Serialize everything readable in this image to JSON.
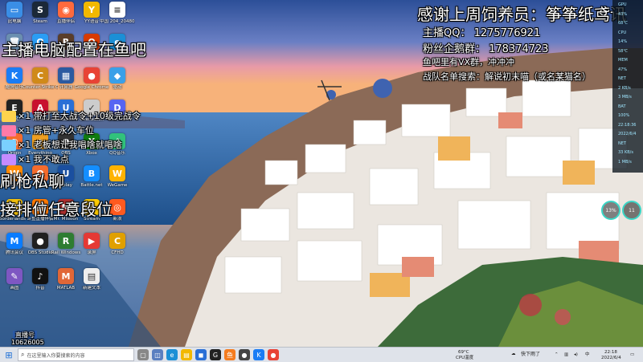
{
  "overlay": {
    "thanks": "感谢上周饲养员：筝筝纸鸢讯",
    "anchor_qq": "主播QQ：  1275776921",
    "fan_group": "粉丝企鹅群：  178374723",
    "vx_group": "鱼吧里有VX群，冲冲冲",
    "team_notice": "战队名单搜索：解说初末喵（或名某猫名）",
    "config": "主播电脑配置在鱼吧",
    "brush": "刷枪私聊",
    "rank": "接排位任意段位",
    "gifts": [
      "×1 带打至大战令+10级完战令",
      "×1 房管+永久车位",
      "×1 老板想让我唱啥就唱啥",
      "×1 我不敢点"
    ],
    "corner_id_label": "直播号",
    "corner_id": "10626005"
  },
  "desktop_icons": [
    {
      "label": "此电脑",
      "glyph": "▭",
      "color": "#3a8ee6"
    },
    {
      "label": "Steam",
      "glyph": "S",
      "color": "#1b2838"
    },
    {
      "label": "直播伴侣",
      "glyph": "◉",
      "color": "#ff6a3d"
    },
    {
      "label": "YY语音",
      "glyph": "Y",
      "color": "#f2b800"
    },
    {
      "label": "中国 204_20480...",
      "glyph": "≡",
      "color": "#ffffff"
    },
    {
      "label": "回收站",
      "glyph": "🗑",
      "color": "#6b8fb0"
    },
    {
      "label": "腾讯QQ",
      "glyph": "Q",
      "color": "#2a9df4"
    },
    {
      "label": "Rising Storm",
      "glyph": "R",
      "color": "#5a3e2b"
    },
    {
      "label": "Office",
      "glyph": "O",
      "color": "#d83b01"
    },
    {
      "label": "Microsoft Edge",
      "glyph": "e",
      "color": "#1b8fd6"
    },
    {
      "label": "酷狗音乐",
      "glyph": "K",
      "color": "#1a7cf5"
    },
    {
      "label": "Counter-Strike Global Off...",
      "glyph": "C",
      "color": "#d08a1a"
    },
    {
      "label": "计算器",
      "glyph": "▦",
      "color": "#2c5aa0"
    },
    {
      "label": "Google Chrome",
      "glyph": "●",
      "color": "#e84335"
    },
    {
      "label": "驱动",
      "glyph": "◆",
      "color": "#3aa0e8"
    },
    {
      "label": "EPIC",
      "glyph": "E",
      "color": "#222222"
    },
    {
      "label": "Adobe",
      "glyph": "A",
      "color": "#c8102e"
    },
    {
      "label": "Ubisoft",
      "glyph": "U",
      "color": "#2a6fd6"
    },
    {
      "label": "Overwatch",
      "glyph": "✓",
      "color": "#cccccc"
    },
    {
      "label": "Discord",
      "glyph": "D",
      "color": "#5865f2"
    },
    {
      "label": "Origin",
      "glyph": "◐",
      "color": "#f56c2d"
    },
    {
      "label": "Everything",
      "glyph": "⌕",
      "color": "#f0a020"
    },
    {
      "label": "OBS",
      "glyph": "●",
      "color": "#333333"
    },
    {
      "label": "Xbox",
      "glyph": "X",
      "color": "#107c10"
    },
    {
      "label": "QQ音乐",
      "glyph": "♪",
      "color": "#31c27c"
    },
    {
      "label": "WeGame",
      "glyph": "W",
      "color": "#ff8a00"
    },
    {
      "label": "Origin",
      "glyph": "O",
      "color": "#f56c2d"
    },
    {
      "label": "Uplay",
      "glyph": "U",
      "color": "#1a4fa0"
    },
    {
      "label": "Battle.net",
      "glyph": "B",
      "color": "#148eff"
    },
    {
      "label": "WeGame",
      "glyph": "W",
      "color": "#ffb300"
    },
    {
      "label": "Borderlands 3",
      "glyph": "3",
      "color": "#f4c20d"
    },
    {
      "label": "斗鱼直播伴侣",
      "glyph": "鱼",
      "color": "#ff7a00"
    },
    {
      "label": "Mr. Mission",
      "glyph": "M",
      "color": "#b03030"
    },
    {
      "label": "Stream",
      "glyph": "S",
      "color": "#ffcc00"
    },
    {
      "label": "新浪",
      "glyph": "◎",
      "color": "#ff5a1f"
    },
    {
      "label": "腾讯会议",
      "glyph": "M",
      "color": "#0a7cff"
    },
    {
      "label": "OBS Studio",
      "glyph": "●",
      "color": "#202020"
    },
    {
      "label": "Rail Windows",
      "glyph": "R",
      "color": "#2e7d32"
    },
    {
      "label": "录屏",
      "glyph": "▶",
      "color": "#e53935"
    },
    {
      "label": "CFHD",
      "glyph": "C",
      "color": "#e0a000"
    },
    {
      "label": "画图",
      "glyph": "✎",
      "color": "#7e57c2"
    },
    {
      "label": "抖音",
      "glyph": "♪",
      "color": "#111111"
    },
    {
      "label": "MATLAB",
      "glyph": "M",
      "color": "#e16737"
    },
    {
      "label": "新建文本",
      "glyph": "▤",
      "color": "#eeeeee"
    }
  ],
  "monitor": {
    "rows": [
      "GPU",
      "43%",
      "68℃",
      "CPU",
      "14%",
      "58℃",
      "MEM",
      "47%",
      "NET",
      "2 KB/s",
      "3 MB/s",
      "BAT",
      "100%",
      "22:18:36",
      "2022/6/4",
      "NET",
      "33 KB/s",
      "1 MB/s"
    ],
    "circle_left": "13%",
    "circle_right": "11"
  },
  "taskbar": {
    "search_placeholder": "在这里输入你要搜索的内容",
    "cpu_temp": "69°C",
    "cpu_label": "CPU温度",
    "weather_text": "快下雨了",
    "time": "22:18",
    "date": "2022/6/4"
  }
}
